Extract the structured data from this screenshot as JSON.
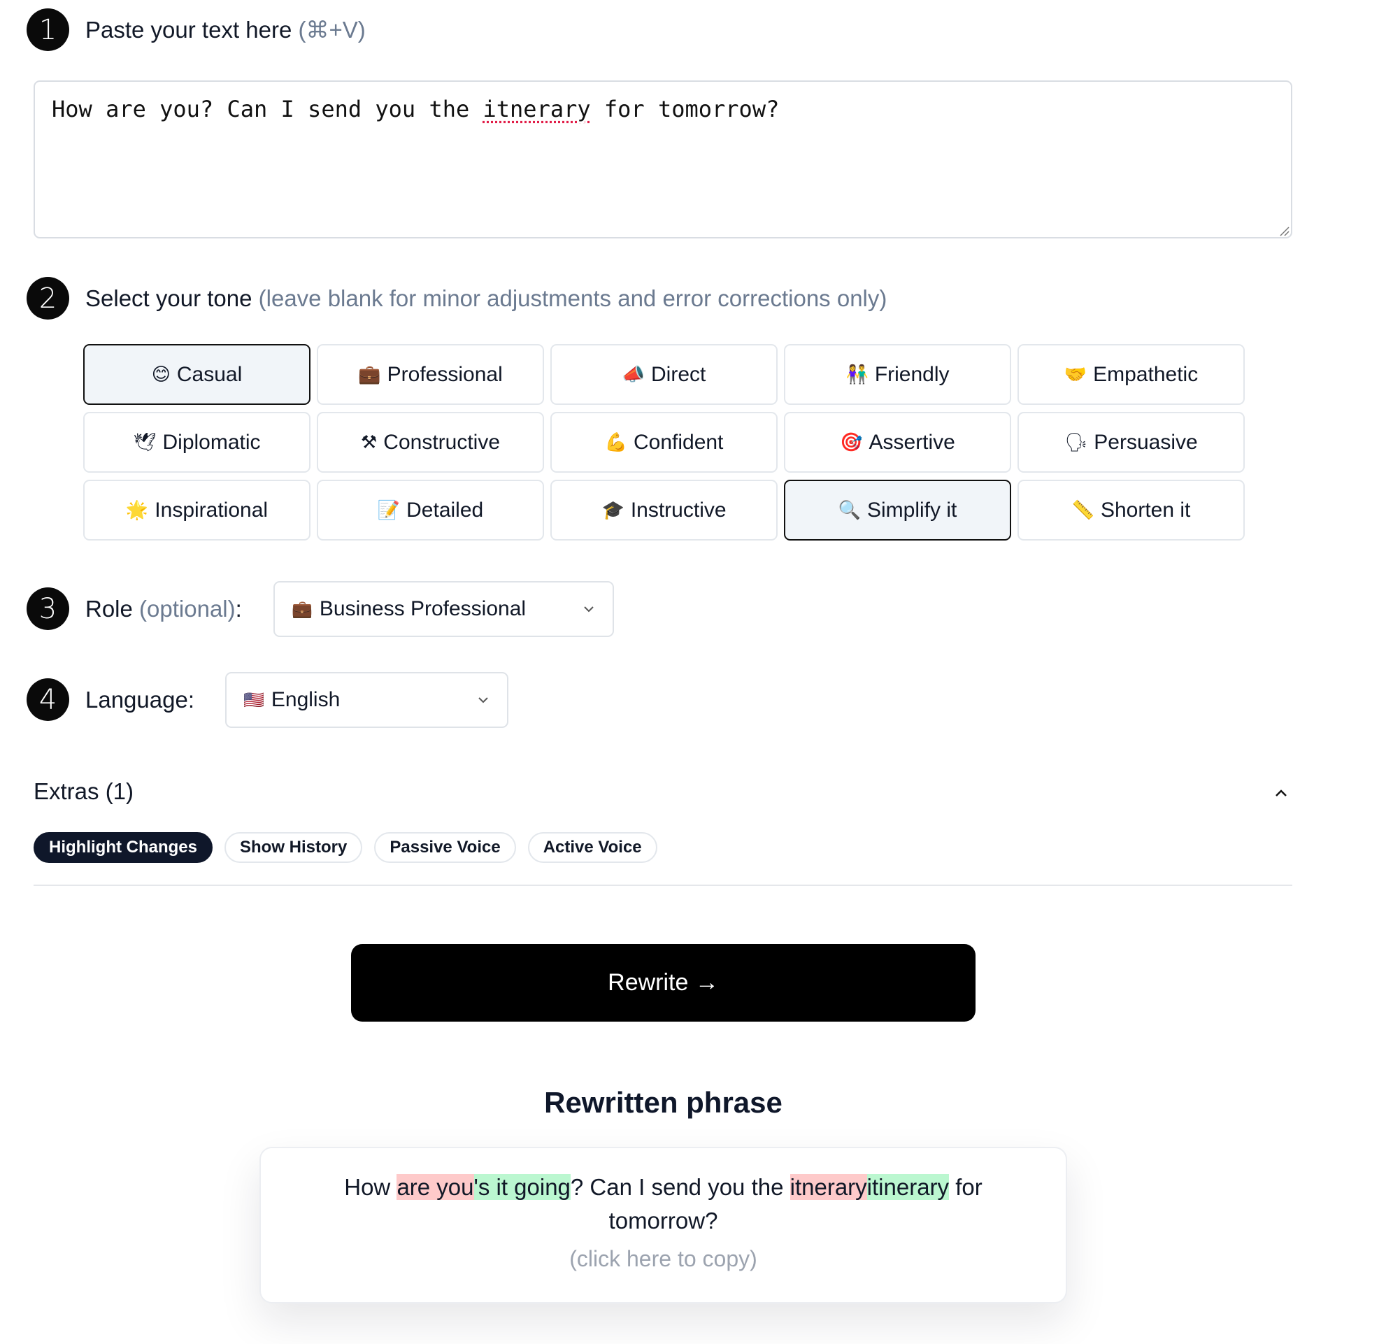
{
  "steps": {
    "paste": {
      "number": "1",
      "label": "Paste your text here",
      "hint": "(⌘+V)"
    },
    "tone": {
      "number": "2",
      "label": "Select your tone",
      "hint": "(leave blank for minor adjustments and error corrections only)"
    },
    "role": {
      "number": "3",
      "label": "Role",
      "hint": "(optional)",
      "suffix": ":"
    },
    "language": {
      "number": "4",
      "label": "Language:"
    }
  },
  "input": {
    "before": "How are you? Can I send you the ",
    "misspelled": "itnerary",
    "after": " for tomorrow?"
  },
  "tones": [
    {
      "emoji": "😊",
      "label": "Casual",
      "selected": true
    },
    {
      "emoji": "💼",
      "label": "Professional",
      "selected": false
    },
    {
      "emoji": "📣",
      "label": "Direct",
      "selected": false
    },
    {
      "emoji": "👫",
      "label": "Friendly",
      "selected": false
    },
    {
      "emoji": "🤝",
      "label": "Empathetic",
      "selected": false
    },
    {
      "emoji": "🕊",
      "label": "Diplomatic",
      "selected": false
    },
    {
      "emoji": "⚒",
      "label": "Constructive",
      "selected": false
    },
    {
      "emoji": "💪",
      "label": "Confident",
      "selected": false
    },
    {
      "emoji": "🎯",
      "label": "Assertive",
      "selected": false
    },
    {
      "emoji": "🗣",
      "label": "Persuasive",
      "selected": false
    },
    {
      "emoji": "🌟",
      "label": "Inspirational",
      "selected": false
    },
    {
      "emoji": "📝",
      "label": "Detailed",
      "selected": false
    },
    {
      "emoji": "🎓",
      "label": "Instructive",
      "selected": false
    },
    {
      "emoji": "🔍",
      "label": "Simplify it",
      "selected": true
    },
    {
      "emoji": "📏",
      "label": "Shorten it",
      "selected": false
    }
  ],
  "role_select": {
    "emoji": "💼",
    "value": "Business Professional",
    "icon": "chevron-down-icon"
  },
  "language_select": {
    "emoji": "🇺🇸",
    "value": "English",
    "icon": "chevron-down-icon"
  },
  "extras": {
    "title": "Extras (1)",
    "toggle_icon": "chevron-up-icon",
    "options": [
      {
        "label": "Highlight Changes",
        "active": true
      },
      {
        "label": "Show History",
        "active": false
      },
      {
        "label": "Passive Voice",
        "active": false
      },
      {
        "label": "Active Voice",
        "active": false
      }
    ]
  },
  "rewrite_button": "Rewrite →",
  "result": {
    "title": "Rewritten phrase",
    "segments": [
      {
        "text": "How ",
        "type": "same"
      },
      {
        "text": "are you",
        "type": "del"
      },
      {
        "text": "'s it going",
        "type": "ins"
      },
      {
        "text": "? Can I send you the ",
        "type": "same"
      },
      {
        "text": "itnerary",
        "type": "del"
      },
      {
        "text": "itinerary",
        "type": "ins"
      },
      {
        "text": " for tomorrow?",
        "type": "same"
      }
    ],
    "copy_hint": "(click here to copy)"
  },
  "colors": {
    "deleted_highlight": "#fecaca",
    "inserted_highlight": "#bbf7d0",
    "primary": "#000000"
  }
}
